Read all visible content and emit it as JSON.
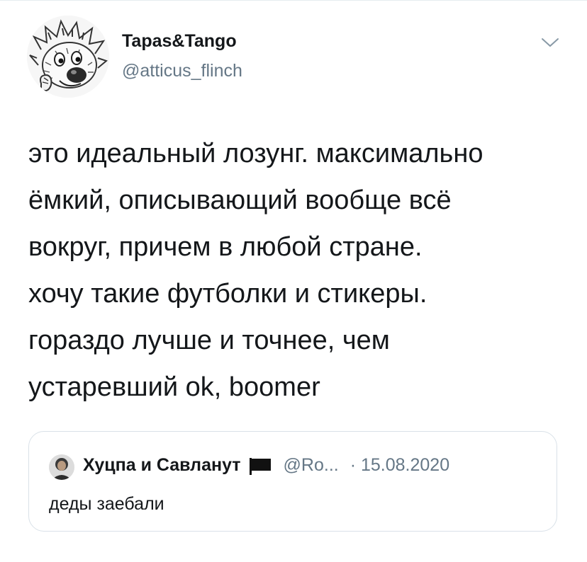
{
  "tweet": {
    "author": {
      "display_name": "Tapas&Tango",
      "handle": "@atticus_flinch",
      "avatar_icon": "cartoon-hedgehog-avatar-icon"
    },
    "menu_icon": "chevron-down-icon",
    "text": "это идеальный лозунг. максимально\nёмкий, описывающий вообще всё\nвокруг, причем в любой стране.\nхочу такие футболки и стикеры.\nгораздо лучше и точнее, чем\nустаревший ok, boomer"
  },
  "quoted_tweet": {
    "display_name": "Хуцпа и Савланут",
    "flag_icon": "black-flag-icon",
    "handle": "@Ro...",
    "date": "· 15.08.2020",
    "text": "деды заебали"
  },
  "colors": {
    "text_primary": "#14171a",
    "text_secondary": "#657786",
    "border": "#d9e1e8"
  }
}
